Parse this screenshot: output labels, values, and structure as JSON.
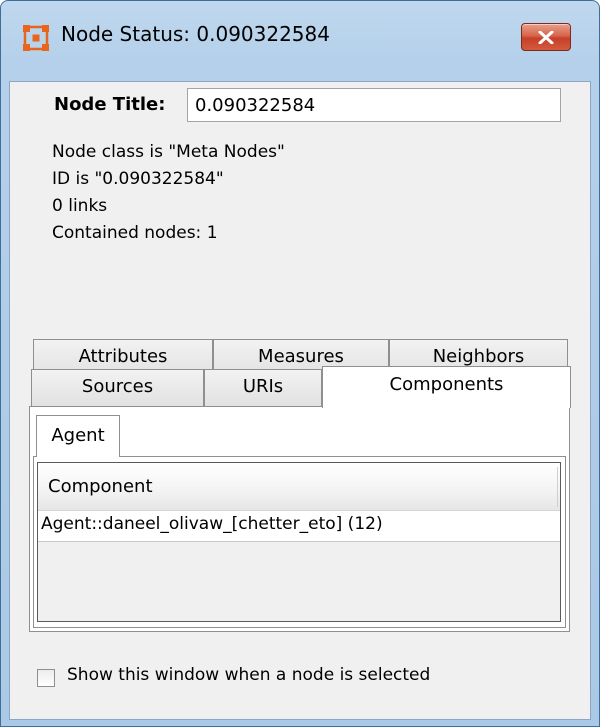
{
  "window": {
    "title": "Node Status: 0.090322584",
    "icon": "network-nodes-icon",
    "close_icon": "close-icon"
  },
  "node_title": {
    "label": "Node Title:",
    "value": "0.090322584"
  },
  "info": {
    "node_class": "Node class is \"Meta Nodes\"",
    "id": "ID is \"0.090322584\"",
    "links": "0 links",
    "contained": "Contained nodes: 1"
  },
  "tabs": {
    "back_row": [
      "Attributes",
      "Measures",
      "Neighbors"
    ],
    "front_row": [
      "Sources",
      "URIs",
      "Components"
    ],
    "active": "Components"
  },
  "components_panel": {
    "subtab": "Agent",
    "table": {
      "columns": [
        "Component"
      ],
      "rows": [
        [
          "Agent::daneel_olivaw_[chetter_eto] (12)"
        ]
      ]
    }
  },
  "footer": {
    "show_window_label": "Show this window when a node is selected",
    "show_window_checked": false
  },
  "colors": {
    "titlebar": "#b5d0ea",
    "close_button": "#c4402a",
    "client_background": "#f0f0f0",
    "app_icon": "#e8651e"
  }
}
